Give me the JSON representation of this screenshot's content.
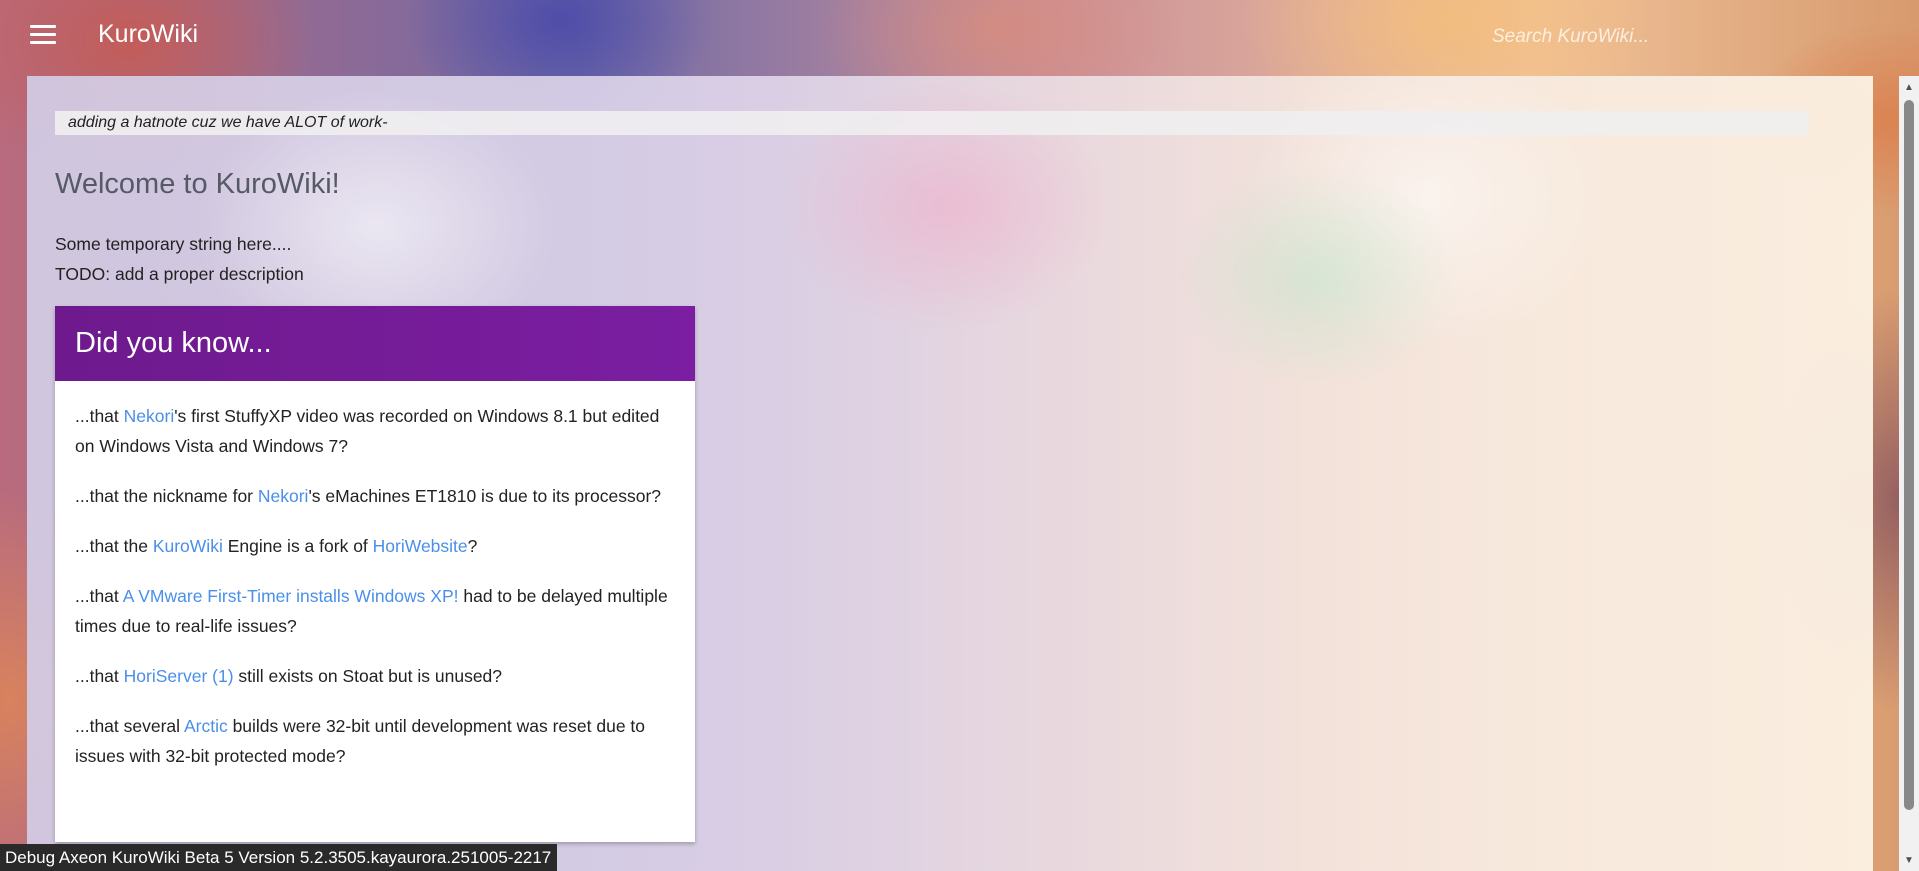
{
  "header": {
    "title": "KuroWiki",
    "search_placeholder": "Search KuroWiki..."
  },
  "main": {
    "hatnote": "adding a hatnote cuz we have ALOT of work-",
    "heading": "Welcome to KuroWiki!",
    "intro_lines": [
      "Some temporary string here....",
      "TODO: add a proper description"
    ],
    "did_you_know": {
      "title": "Did you know...",
      "items": [
        {
          "before": "...that ",
          "link": "Nekori",
          "after": "'s first StuffyXP video was recorded on Windows 8.1 but edited on Windows Vista and Windows 7?"
        },
        {
          "before": "...that the nickname for ",
          "link": "Nekori",
          "after": "'s eMachines ET1810 is due to its processor?"
        },
        {
          "before": "...that the ",
          "link": "KuroWiki",
          "middle": " Engine is a fork of ",
          "link2": "HoriWebsite",
          "after": "?"
        },
        {
          "before": "...that ",
          "link": "A VMware First-Timer installs Windows XP!",
          "after": " had to be delayed multiple times due to real-life issues?"
        },
        {
          "before": "...that ",
          "link": "HoriServer (1)",
          "after": " still exists on Stoat but is unused?"
        },
        {
          "before": "...that several ",
          "link": "Arctic",
          "after": " builds were 32-bit until development was reset due to issues with 32-bit protected mode?"
        }
      ]
    }
  },
  "footer": {
    "debug_text": "Debug Axeon KuroWiki Beta 5 Version 5.2.3505.kayaurora.251005-2217"
  },
  "icons": {
    "menu": "hamburger-menu-icon",
    "scroll_up": "scroll-up-arrow-icon",
    "scroll_down": "scroll-down-arrow-icon"
  },
  "colors": {
    "accent_purple": "#7b1ea2",
    "link_blue": "#4a8fe8"
  }
}
